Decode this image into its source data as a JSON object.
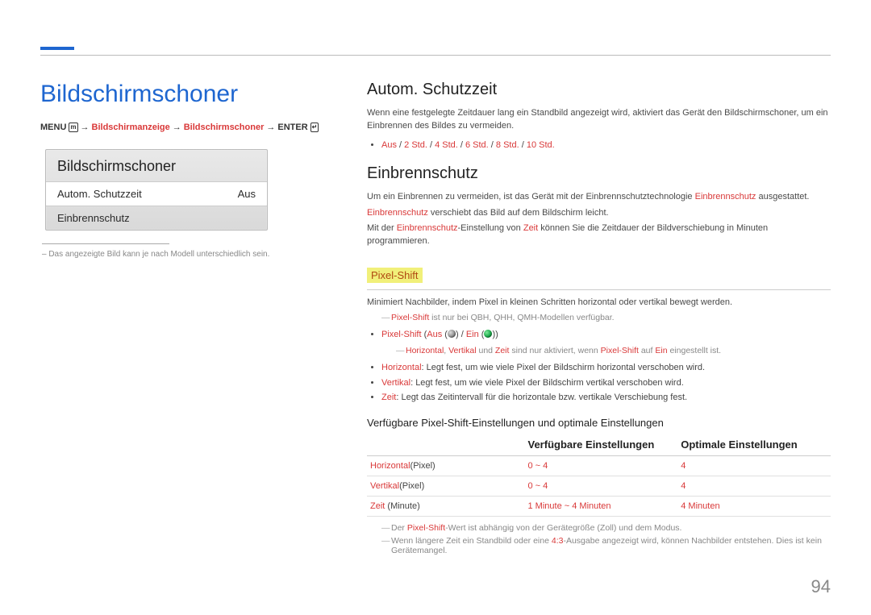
{
  "page_title": "Bildschirmschoner",
  "breadcrumb": {
    "menu": "MENU",
    "arrow": "→",
    "part1": "Bildschirmanzeige",
    "part2": "Bildschirmschoner",
    "enter": "ENTER"
  },
  "ui_card": {
    "title": "Bildschirmschoner",
    "row1_label": "Autom. Schutzzeit",
    "row1_value": "Aus",
    "row2_label": "Einbrennschutz"
  },
  "card_note": "– Das angezeigte Bild kann je nach Modell unterschiedlich sein.",
  "s1": {
    "h": "Autom. Schutzzeit",
    "p1a": "Wenn eine festgelegte Zeitdauer lang ein Standbild angezeigt wird, aktiviert das Gerät den Bildschirmschoner, um ein Einbrennen des Bildes zu vermeiden.",
    "bullets": {
      "opt_aus": "Aus",
      "slash": " / ",
      "opt_2": "2 Std.",
      "opt_4": "4 Std.",
      "opt_6": "6 Std.",
      "opt_8": "8 Std.",
      "opt_10": "10 Std."
    }
  },
  "s2": {
    "h": "Einbrennschutz",
    "p1_a": "Um ein Einbrennen zu vermeiden, ist das Gerät mit der Einbrennschutztechnologie ",
    "p1_red": "Einbrennschutz",
    "p1_b": " ausgestattet.",
    "p2_red": "Einbrennschutz",
    "p2_b": " verschiebt das Bild auf dem Bildschirm leicht.",
    "p3_a": "Mit der ",
    "p3_red1": "Einbrennschutz",
    "p3_b": "-Einstellung von ",
    "p3_red2": "Zeit",
    "p3_c": " können Sie die Zeitdauer der Bildverschiebung in Minuten programmieren."
  },
  "s3": {
    "h": "Pixel-Shift",
    "p1": "Minimiert Nachbilder, indem Pixel in kleinen Schritten horizontal oder vertikal bewegt werden.",
    "note1_red": "Pixel-Shift",
    "note1_rest": " ist nur bei QBH, QHH, QMH-Modellen verfügbar.",
    "b1_red": "Pixel-Shift",
    "b1_paren_a": " (",
    "b1_aus": "Aus",
    "b1_sep": " (",
    "b1_close": ")",
    "b1_slash": " / ",
    "b1_ein": "Ein",
    "note2_r1": "Horizontal",
    "note2_c1": ", ",
    "note2_r2": "Vertikal",
    "note2_c2": " und ",
    "note2_r3": "Zeit",
    "note2_m": " sind nur aktiviert, wenn ",
    "note2_r4": "Pixel-Shift",
    "note2_m2": " auf ",
    "note2_r5": "Ein",
    "note2_e": " eingestellt ist.",
    "b2_red": "Horizontal",
    "b2_rest": ": Legt fest, um wie viele Pixel der Bildschirm horizontal verschoben wird.",
    "b3_red": "Vertikal",
    "b3_rest": ": Legt fest, um wie viele Pixel der Bildschirm vertikal verschoben wird.",
    "b4_red": "Zeit",
    "b4_rest": ": Legt das Zeitintervall für die horizontale bzw. vertikale Verschiebung fest."
  },
  "tbl": {
    "title": "Verfügbare Pixel-Shift-Einstellungen und optimale Einstellungen",
    "th0": "",
    "th1": "Verfügbare Einstellungen",
    "th2": "Optimale Einstellungen",
    "r1c0a": "Horizontal",
    "r1c0b": "(Pixel)",
    "r1c1": "0 ~ 4",
    "r1c2": "4",
    "r2c0a": "Vertikal",
    "r2c0b": "(Pixel)",
    "r2c1": "0 ~ 4",
    "r2c2": "4",
    "r3c0a": "Zeit",
    "r3c0b": " (Minute)",
    "r3c1": "1 Minute ~ 4 Minuten",
    "r3c2": "4 Minuten"
  },
  "foot_note1_a": "Der ",
  "foot_note1_red": "Pixel-Shift",
  "foot_note1_b": "-Wert ist abhängig von der Gerätegröße (Zoll) und dem Modus.",
  "foot_note2_a": "Wenn längere Zeit ein Standbild oder eine ",
  "foot_note2_red": "4:3",
  "foot_note2_b": "-Ausgabe angezeigt wird, können Nachbilder entstehen. Dies ist kein Gerätemangel.",
  "page_number": "94"
}
